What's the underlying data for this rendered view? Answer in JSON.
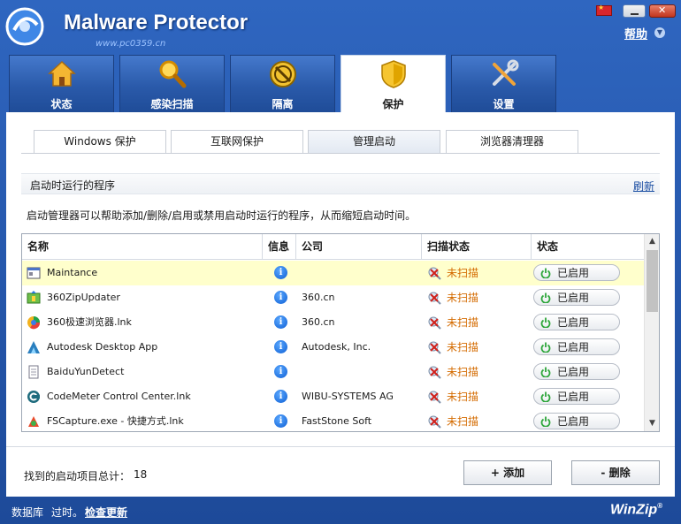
{
  "window": {
    "title": "Malware Protector",
    "watermark": "www.pc0359.cn",
    "help_label": "帮助"
  },
  "main_tabs": [
    {
      "label": "状态",
      "icon": "home-icon"
    },
    {
      "label": "感染扫描",
      "icon": "magnifier-icon"
    },
    {
      "label": "隔离",
      "icon": "quarantine-icon"
    },
    {
      "label": "保护",
      "icon": "shield-icon",
      "active": true
    },
    {
      "label": "设置",
      "icon": "tools-icon"
    }
  ],
  "sub_tabs": [
    {
      "label": "Windows 保护"
    },
    {
      "label": "互联网保护"
    },
    {
      "label": "管理启动",
      "active": true
    },
    {
      "label": "浏览器清理器"
    }
  ],
  "section": {
    "title": "启动时运行的程序",
    "refresh_label": "刷新",
    "description": "启动管理器可以帮助添加/删除/启用或禁用启动时运行的程序，从而缩短启动时间。"
  },
  "table": {
    "columns": [
      "名称",
      "信息",
      "公司",
      "扫描状态",
      "状态"
    ],
    "rows": [
      {
        "name": "Maintance",
        "company": "",
        "scan": "未扫描",
        "status": "已启用",
        "icon": "window-icon",
        "highlight": true
      },
      {
        "name": "360ZipUpdater",
        "company": "360.cn",
        "scan": "未扫描",
        "status": "已启用",
        "icon": "zip-updater-icon"
      },
      {
        "name": "360极速浏览器.lnk",
        "company": "360.cn",
        "scan": "未扫描",
        "status": "已启用",
        "icon": "browser-icon"
      },
      {
        "name": "Autodesk Desktop App",
        "company": "Autodesk, Inc.",
        "scan": "未扫描",
        "status": "已启用",
        "icon": "autodesk-icon"
      },
      {
        "name": "BaiduYunDetect",
        "company": "",
        "scan": "未扫描",
        "status": "已启用",
        "icon": "document-icon"
      },
      {
        "name": "CodeMeter Control Center.lnk",
        "company": "WIBU-SYSTEMS AG",
        "scan": "未扫描",
        "status": "已启用",
        "icon": "codemeter-icon"
      },
      {
        "name": "FSCapture.exe - 快捷方式.lnk",
        "company": "FastStone Soft",
        "scan": "未扫描",
        "status": "已启用",
        "icon": "capture-icon"
      }
    ]
  },
  "footer_bar": {
    "found_label": "找到的启动项目总计：",
    "found_count": "18",
    "add_label": "+  添加",
    "delete_label": "-  删除"
  },
  "status_bar": {
    "db_label": "数据库",
    "db_status": "过时。",
    "update_label": "检查更新",
    "brand": "WinZip",
    "brand_mark": "®"
  },
  "colors": {
    "frame_blue": "#2556a8",
    "scan_warning": "#d46b00",
    "highlight_row": "#ffffcc",
    "link_blue": "#1b4ea3"
  }
}
